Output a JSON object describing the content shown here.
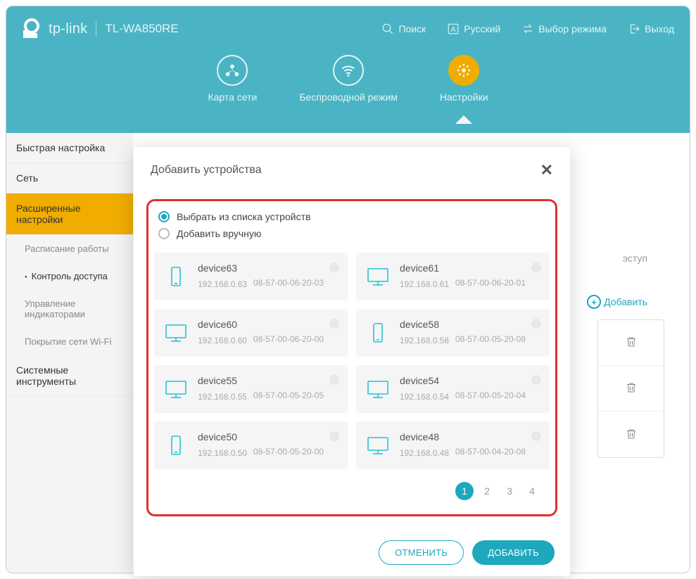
{
  "brand": "tp-link",
  "model": "TL-WA850RE",
  "top_links": {
    "search": "Поиск",
    "lang": "Русский",
    "mode": "Выбор режима",
    "logout": "Выход"
  },
  "nav": {
    "map": "Карта сети",
    "wireless": "Беспроводной режим",
    "settings": "Настройки"
  },
  "sidebar": {
    "quick": "Быстрая настройка",
    "network": "Сеть",
    "advanced": "Расширенные настройки",
    "schedule": "Расписание работы",
    "access": "Контроль доступа",
    "leds": "Управление индикаторами",
    "coverage": "Покрытие сети Wi-Fi",
    "system": "Системные инструменты"
  },
  "content": {
    "access_hint": "эступ",
    "add": "Добавить"
  },
  "modal": {
    "title": "Добавить устройства",
    "opt_list": "Выбрать из списка устройств",
    "opt_manual": "Добавить вручную",
    "cancel": "ОТМЕНИТЬ",
    "add": "ДОБАВИТЬ",
    "pages": [
      "1",
      "2",
      "3",
      "4"
    ]
  },
  "devices": [
    {
      "name": "device63",
      "ip": "192.168.0.63",
      "mac": "08-57-00-06-20-03",
      "type": "mobile"
    },
    {
      "name": "device61",
      "ip": "192.168.0.61",
      "mac": "08-57-00-06-20-01",
      "type": "pc"
    },
    {
      "name": "device60",
      "ip": "192.168.0.60",
      "mac": "08-57-00-06-20-00",
      "type": "pc"
    },
    {
      "name": "device58",
      "ip": "192.168.0.58",
      "mac": "08-57-00-05-20-08",
      "type": "mobile"
    },
    {
      "name": "device55",
      "ip": "192.168.0.55",
      "mac": "08-57-00-05-20-05",
      "type": "pc"
    },
    {
      "name": "device54",
      "ip": "192.168.0.54",
      "mac": "08-57-00-05-20-04",
      "type": "pc"
    },
    {
      "name": "device50",
      "ip": "192.168.0.50",
      "mac": "08-57-00-05-20-00",
      "type": "mobile"
    },
    {
      "name": "device48",
      "ip": "192.168.0.48",
      "mac": "08-57-00-04-20-08",
      "type": "pc"
    }
  ]
}
